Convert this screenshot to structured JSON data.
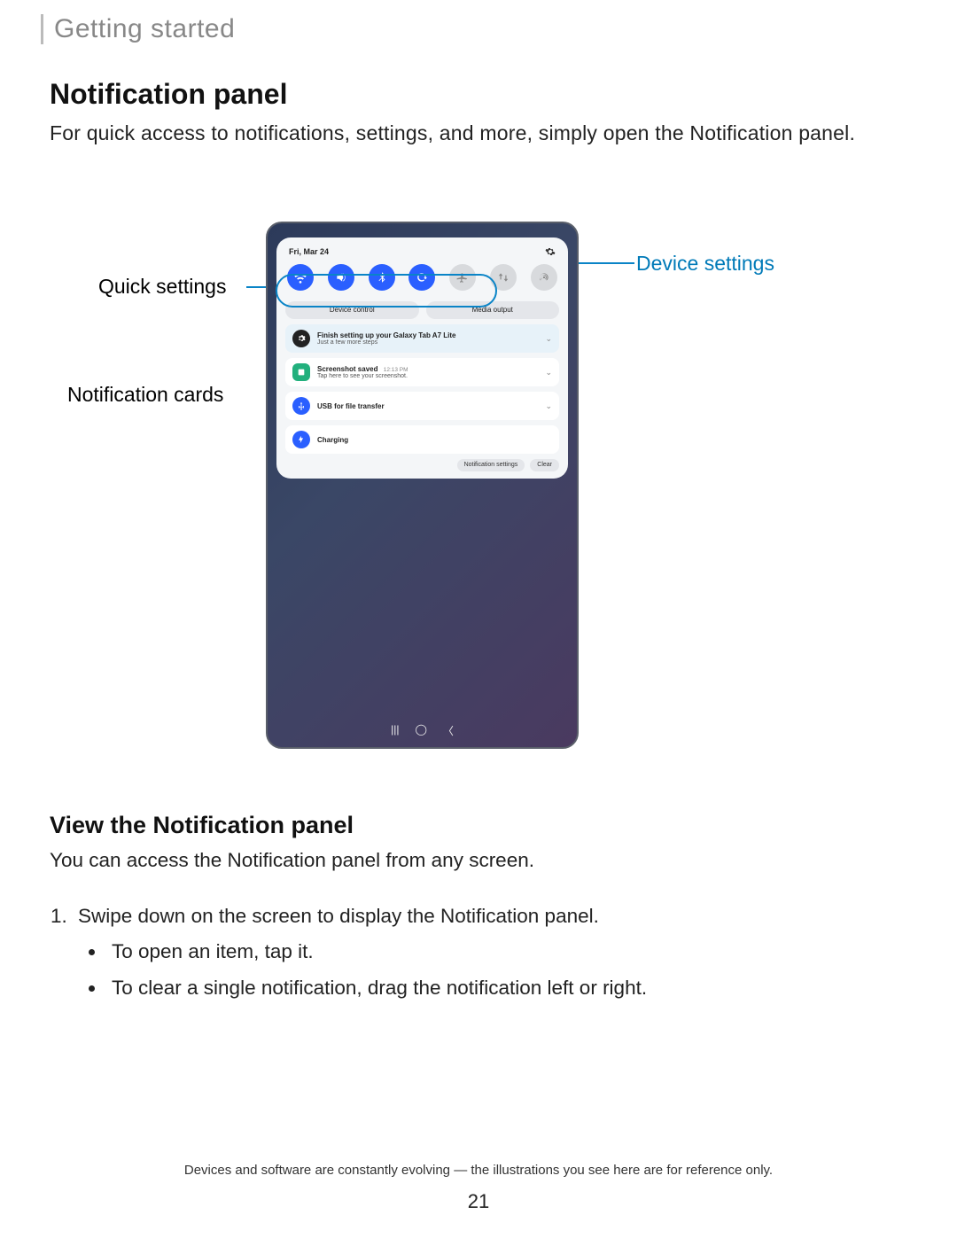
{
  "header": {
    "section": "Getting started"
  },
  "main": {
    "title": "Notification panel",
    "intro": "For quick access to notifications, settings, and more, simply open the Notification panel."
  },
  "callouts": {
    "quick_settings": "Quick settings",
    "device_settings": "Device settings",
    "notification_cards": "Notification cards"
  },
  "panel": {
    "date": "Fri, Mar 24",
    "qs_icons": [
      {
        "name": "wifi-icon",
        "on": true
      },
      {
        "name": "sound-icon",
        "on": true
      },
      {
        "name": "bluetooth-icon",
        "on": true
      },
      {
        "name": "rotate-icon",
        "on": true
      },
      {
        "name": "airplane-icon",
        "on": false
      },
      {
        "name": "mobile-data-icon",
        "on": false
      },
      {
        "name": "hotspot-icon",
        "on": false
      }
    ],
    "buttons": {
      "device_control": "Device control",
      "media_output": "Media output"
    },
    "notifications": [
      {
        "title": "Finish setting up your Galaxy Tab A7 Lite",
        "sub": "Just a few more steps"
      },
      {
        "title": "Screenshot saved",
        "time": "12:13 PM",
        "sub": "Tap here to see your screenshot."
      },
      {
        "title": "USB for file transfer"
      },
      {
        "title": "Charging"
      }
    ],
    "footer": {
      "notif_settings": "Notification settings",
      "clear": "Clear"
    }
  },
  "view": {
    "heading": "View the Notification panel",
    "lead": "You can access the Notification panel from any screen.",
    "step1": "Swipe down on the screen to display the Notification panel.",
    "bullet1": "To open an item, tap it.",
    "bullet2": "To clear a single notification, drag the notification left or right."
  },
  "footer": {
    "note": "Devices and software are constantly evolving — the illustrations you see here are for reference only.",
    "page": "21"
  }
}
